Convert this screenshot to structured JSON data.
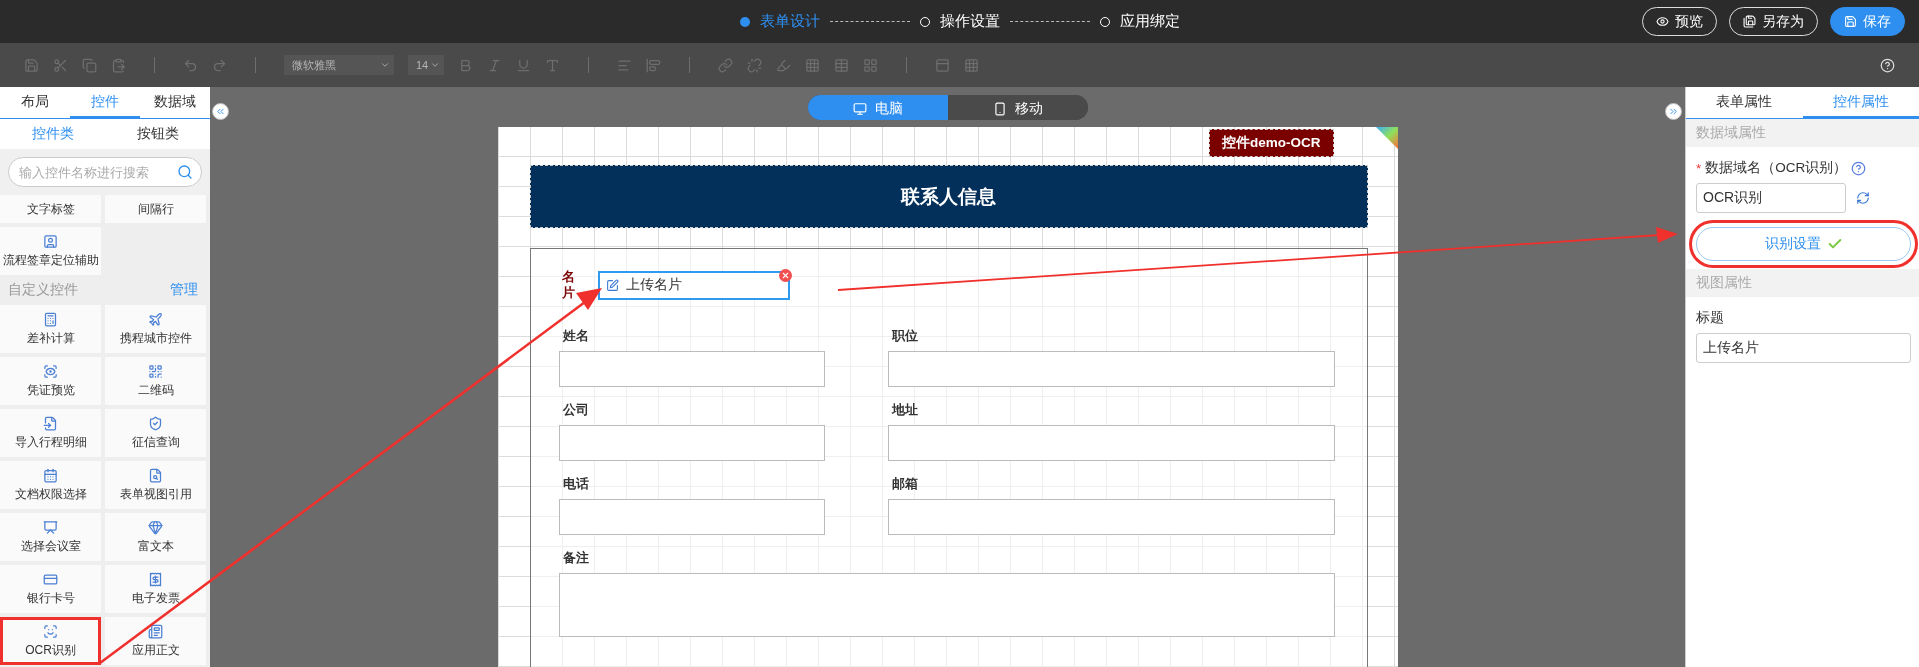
{
  "top_bar": {
    "steps": [
      {
        "label": "表单设计",
        "selected": true
      },
      {
        "label": "操作设置",
        "selected": false
      },
      {
        "label": "应用绑定",
        "selected": false
      }
    ],
    "buttons": [
      {
        "label": "预览",
        "kind": "preview"
      },
      {
        "label": "另存为",
        "kind": "save_as"
      },
      {
        "label": "保存",
        "kind": "save"
      }
    ]
  },
  "toolbar": {
    "disabled": true,
    "font": "微软雅黑",
    "font_size": "14"
  },
  "sidebar": {
    "tabs": [
      {
        "label": "布局",
        "selected": false
      },
      {
        "label": "控件",
        "selected": true
      },
      {
        "label": "数据域",
        "selected": false
      }
    ],
    "subtabs": [
      {
        "label": "控件类",
        "selected": true
      },
      {
        "label": "按钮类",
        "selected": false
      }
    ],
    "search": {
      "placeholder": "输入控件名称进行搜索"
    },
    "groups": [
      {
        "items": [
          {
            "label": "文字标签",
            "highlighted": false
          },
          {
            "label": "间隔行",
            "highlighted": false
          },
          {
            "label": "流程签章定位辅助",
            "highlighted": false
          }
        ]
      },
      {
        "title": "自定义控件",
        "action": "管理",
        "items": [
          {
            "label": "差补计算",
            "highlighted": false
          },
          {
            "label": "携程城市控件",
            "highlighted": false
          },
          {
            "label": "凭证预览",
            "highlighted": false
          },
          {
            "label": "二维码",
            "highlighted": false
          },
          {
            "label": "导入行程明细",
            "highlighted": false
          },
          {
            "label": "征信查询",
            "highlighted": false
          },
          {
            "label": "文档权限选择",
            "highlighted": false
          },
          {
            "label": "表单视图引用",
            "highlighted": false
          },
          {
            "label": "选择会议室",
            "highlighted": false
          },
          {
            "label": "富文本",
            "highlighted": false
          },
          {
            "label": "银行卡号",
            "highlighted": false
          },
          {
            "label": "电子发票",
            "highlighted": false
          },
          {
            "label": "OCR识别",
            "highlighted": true
          },
          {
            "label": "应用正文",
            "highlighted": false
          }
        ]
      }
    ]
  },
  "canvas": {
    "device_tabs": [
      {
        "label": "电脑",
        "kind": "desktop",
        "selected": true
      },
      {
        "label": "移动",
        "kind": "mobile",
        "selected": false
      }
    ],
    "form": {
      "badge": "控件demo-OCR",
      "title": "联系人信息",
      "upload": {
        "label": "名片",
        "value": "上传名片",
        "selected": true
      },
      "fields": [
        {
          "label": "姓名",
          "kind": "text"
        },
        {
          "label": "职位",
          "kind": "text"
        },
        {
          "label": "公司",
          "kind": "text"
        },
        {
          "label": "地址",
          "kind": "text"
        },
        {
          "label": "电话",
          "kind": "text"
        },
        {
          "label": "邮箱",
          "kind": "text"
        },
        {
          "label": "备注",
          "kind": "textarea"
        }
      ]
    }
  },
  "properties": {
    "tabs": [
      {
        "label": "表单属性",
        "selected": false
      },
      {
        "label": "控件属性",
        "selected": true
      }
    ],
    "data_section": {
      "title": "数据域属性",
      "required_mark": "*",
      "field_label": "数据域名（OCR识别）",
      "value": "OCR识别",
      "button": {
        "label": "识别设置",
        "done": true,
        "highlighted": true
      }
    },
    "view_section": {
      "title": "视图属性",
      "field_label": "标题",
      "value": "上传名片"
    }
  }
}
